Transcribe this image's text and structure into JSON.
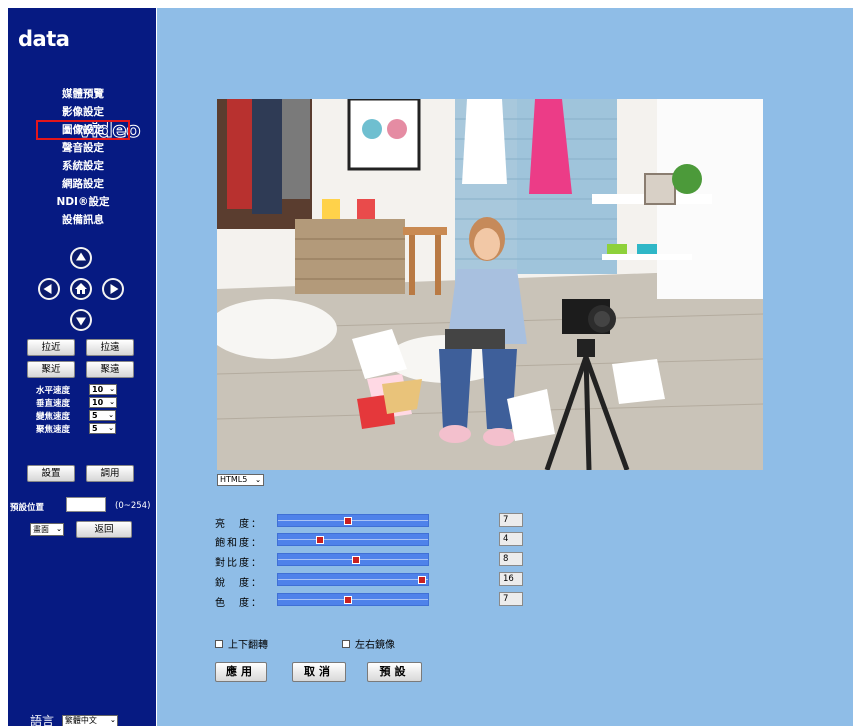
{
  "logo": {
    "data": "data",
    "video": "video"
  },
  "menu": [
    {
      "label": "媒體預覽",
      "active": false
    },
    {
      "label": "影像設定",
      "active": false
    },
    {
      "label": "圖像設定",
      "active": true
    },
    {
      "label": "聲音設定",
      "active": false
    },
    {
      "label": "系統設定",
      "active": false
    },
    {
      "label": "網路設定",
      "active": false
    },
    {
      "label": "NDI®設定",
      "active": false
    },
    {
      "label": "設備訊息",
      "active": false
    }
  ],
  "ptz": {
    "zoom_in": "拉近",
    "zoom_out": "拉遠",
    "focus_near": "聚近",
    "focus_far": "聚遠",
    "speeds": [
      {
        "label": "水平速度",
        "value": "10"
      },
      {
        "label": "垂直速度",
        "value": "10"
      },
      {
        "label": "變焦速度",
        "value": "5"
      },
      {
        "label": "聚焦速度",
        "value": "5"
      }
    ],
    "set": "設置",
    "call": "調用",
    "preset_label": "預設位置",
    "preset_value": "",
    "preset_range": "(0~254)",
    "mode_value": "畫面",
    "back": "返回"
  },
  "language": {
    "label": "語言",
    "value": "繁體中文"
  },
  "stream_select": "HTML5",
  "adjustments": [
    {
      "label": "亮　度：",
      "value": "7",
      "fraction": 0.47
    },
    {
      "label": "飽和度：",
      "value": "4",
      "fraction": 0.27
    },
    {
      "label": "對比度：",
      "value": "8",
      "fraction": 0.53
    },
    {
      "label": "銳　度：",
      "value": "16",
      "fraction": 1.0
    },
    {
      "label": "色　度：",
      "value": "7",
      "fraction": 0.47
    }
  ],
  "flip": {
    "label": "上下翻轉",
    "checked": false
  },
  "mirror": {
    "label": "左右鏡像",
    "checked": false
  },
  "buttons": {
    "apply": "應用",
    "cancel": "取消",
    "default": "預設"
  },
  "colors": {
    "sidebar": "#061a82",
    "main": "#8fbde7",
    "slider": "#4f82ea",
    "thumb": "#c92020",
    "active_outline": "#e3161b"
  }
}
